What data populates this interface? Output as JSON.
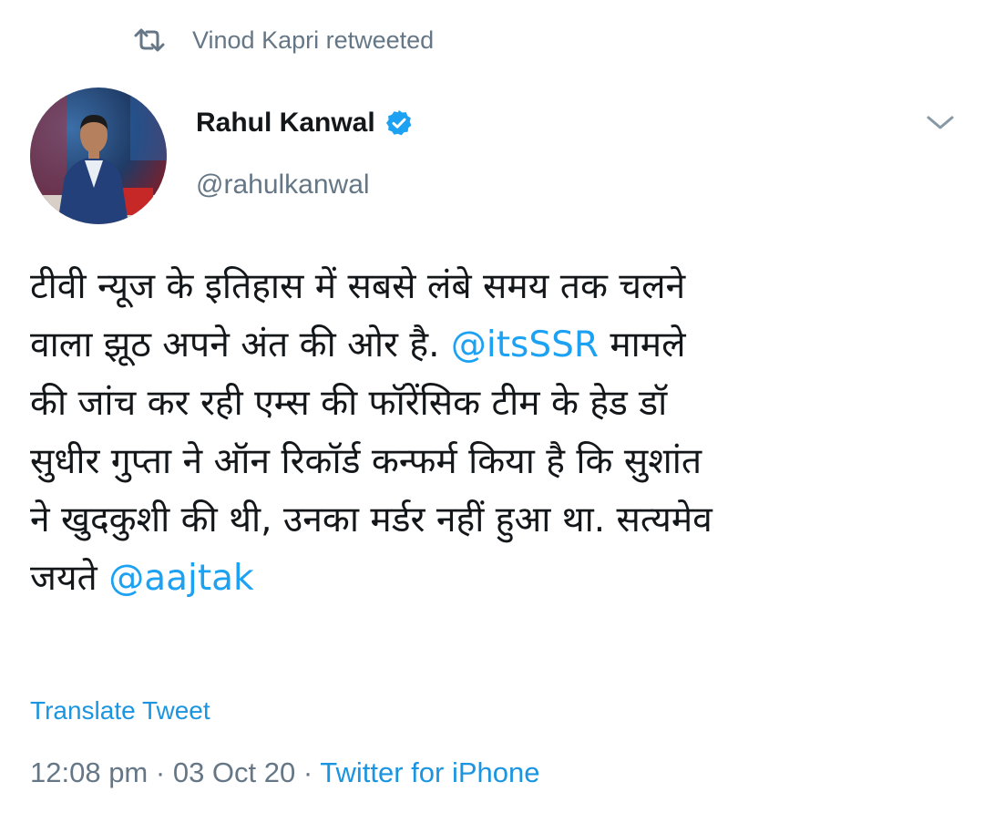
{
  "retweet": {
    "icon": "retweet-icon",
    "text": "Vinod Kapri retweeted"
  },
  "author": {
    "name": "Rahul Kanwal",
    "handle": "@rahulkanwal",
    "verified": true,
    "verified_icon": "verified-badge-icon",
    "avatar_icon": "avatar"
  },
  "tweet": {
    "line1": "टीवी न्यूज के इतिहास में सबसे लंबे समय तक चलने",
    "line2_before": "वाला झूठ अपने अंत की ओर है. ",
    "mention_1": "@itsSSR",
    "line2_after": " मामले",
    "line3": "की जांच कर रही एम्स की फॉरेंसिक टीम के हेड डॉ",
    "line4": "सुधीर गुप्ता ने ऑन रिकॉर्ड कन्फर्म किया है कि सुशांत",
    "line5": "ने खुदकुशी की थी, उनका मर्डर नहीं हुआ था. सत्यमेव",
    "line6_before": "जयते ",
    "mention_2": "@aajtak"
  },
  "translate_label": "Translate Tweet",
  "meta": {
    "time": "12:08 pm",
    "separator": " · ",
    "date": "03 Oct 20",
    "source": "Twitter for iPhone"
  },
  "colors": {
    "link": "#1da1f2",
    "secondary_text": "#657786",
    "primary_text": "#14171a",
    "verified": "#1da1f2"
  }
}
